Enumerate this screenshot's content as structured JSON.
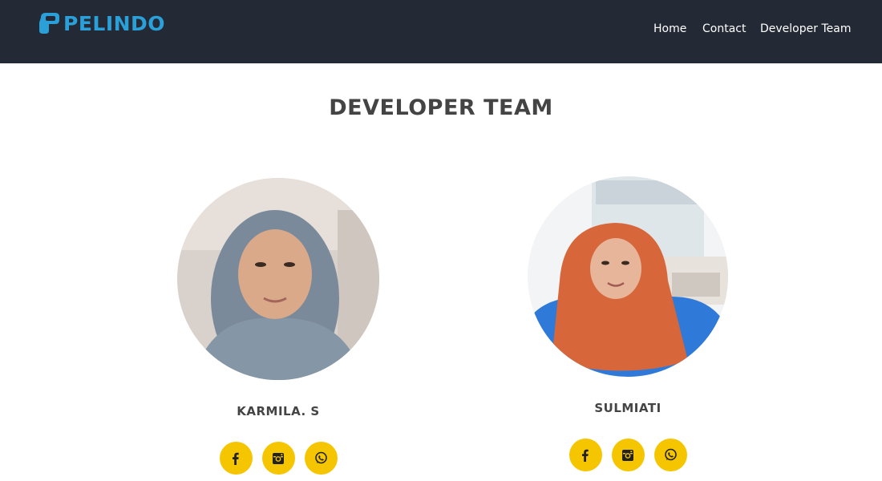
{
  "brand": {
    "name": "PELINDO",
    "logo_icon": "pelindo-logo-icon"
  },
  "nav": {
    "items": [
      {
        "label": "Home"
      },
      {
        "label": "Contact"
      },
      {
        "label": "Developer Team"
      }
    ]
  },
  "section": {
    "title": "DEVELOPER TEAM"
  },
  "team": [
    {
      "name": "KARMILA. S",
      "socials": [
        "facebook-icon",
        "instagram-icon",
        "whatsapp-icon"
      ]
    },
    {
      "name": "SULMIATI",
      "socials": [
        "facebook-icon",
        "instagram-icon",
        "whatsapp-icon"
      ]
    }
  ],
  "colors": {
    "navbar": "#242936",
    "brand": "#2a9fd8",
    "accent": "#f5c600",
    "heading": "#444444"
  }
}
